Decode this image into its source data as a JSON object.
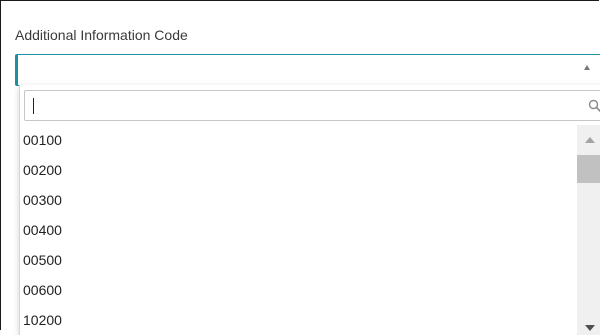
{
  "field": {
    "label": "Additional Information Code",
    "value": ""
  },
  "search": {
    "value": "",
    "placeholder": ""
  },
  "options": [
    "00100",
    "00200",
    "00300",
    "00400",
    "00500",
    "00600",
    "10200"
  ],
  "icons": {
    "search": "search-icon",
    "combo_toggle": "chevron-up-icon",
    "scroll_up": "scroll-up-arrow-icon",
    "scroll_down": "scroll-down-arrow-icon"
  },
  "colors": {
    "focus_border": "#1d8fa0",
    "scroll_thumb": "#c1c1c1",
    "scroll_track": "#f0f0f0"
  }
}
